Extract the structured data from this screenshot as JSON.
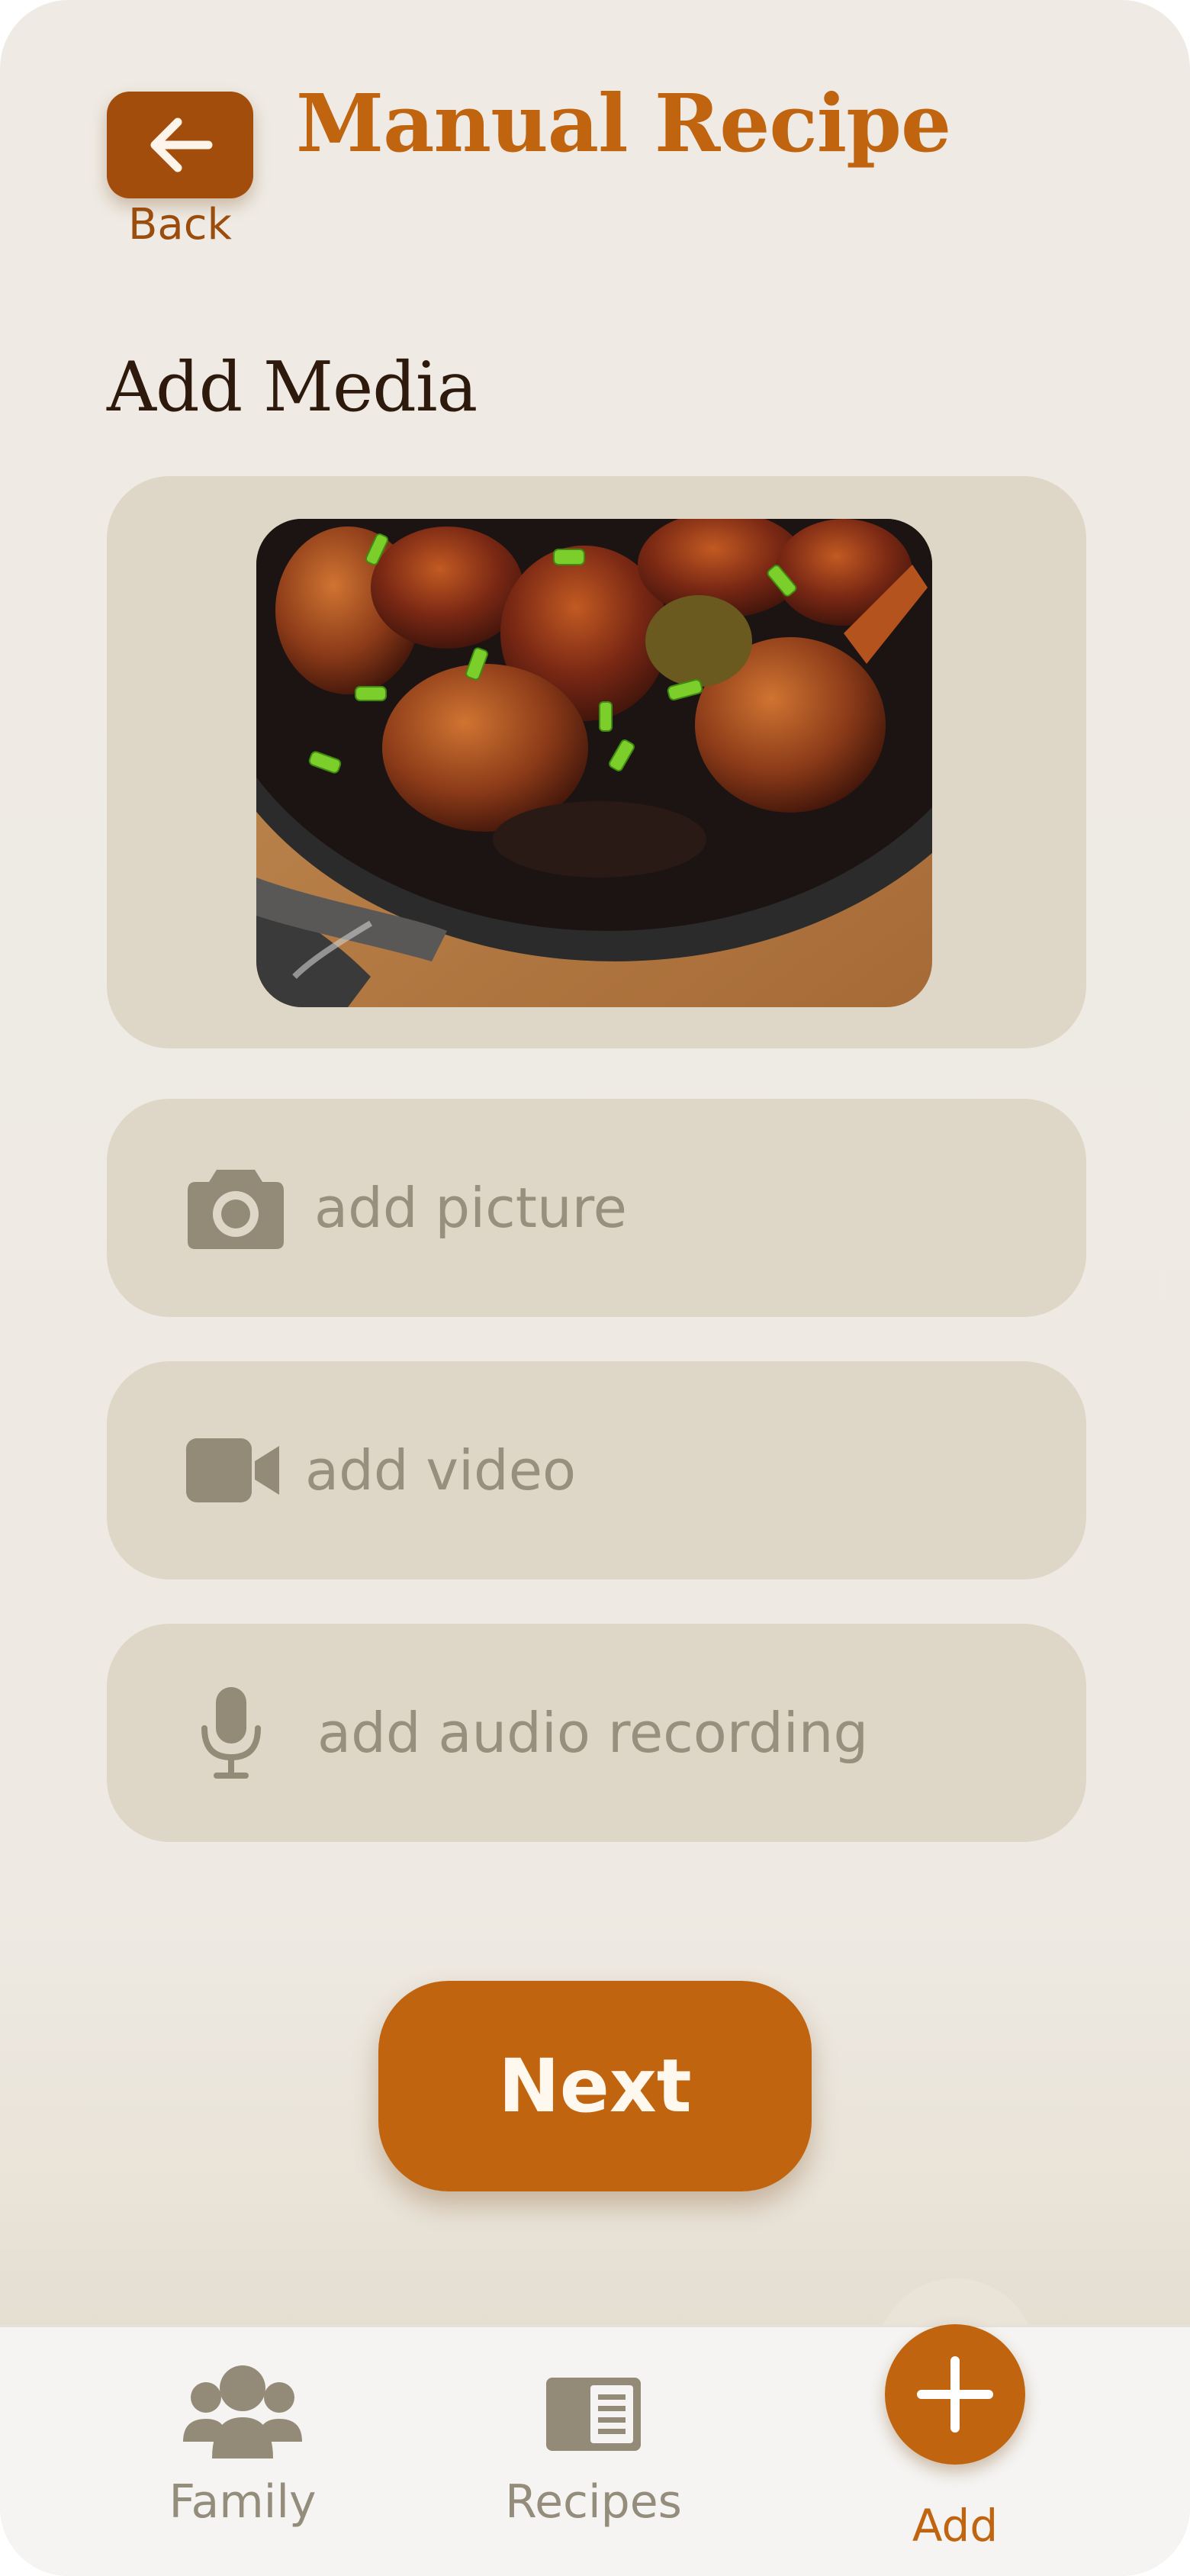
{
  "header": {
    "back_label": "Back",
    "title": "Manual Recipe"
  },
  "section": {
    "title": "Add Media"
  },
  "media": {
    "preview_alt": "Photo of braised chicken with green onions in a dark cast iron pot"
  },
  "add_options": [
    {
      "label": "add picture",
      "icon": "camera-icon"
    },
    {
      "label": "add video",
      "icon": "video-camera-icon"
    },
    {
      "label": "add audio recording",
      "icon": "microphone-icon"
    }
  ],
  "actions": {
    "next_label": "Next"
  },
  "bottom_nav": {
    "items": [
      {
        "label": "Family",
        "icon": "family-icon"
      },
      {
        "label": "Recipes",
        "icon": "recipe-book-icon"
      },
      {
        "label": "Add",
        "icon": "plus-icon"
      }
    ]
  },
  "colors": {
    "accent": "#c0640f",
    "back_button": "#a24d0c",
    "card": "#ded6c7",
    "background": "#efebe4",
    "muted_text": "#98907f"
  }
}
